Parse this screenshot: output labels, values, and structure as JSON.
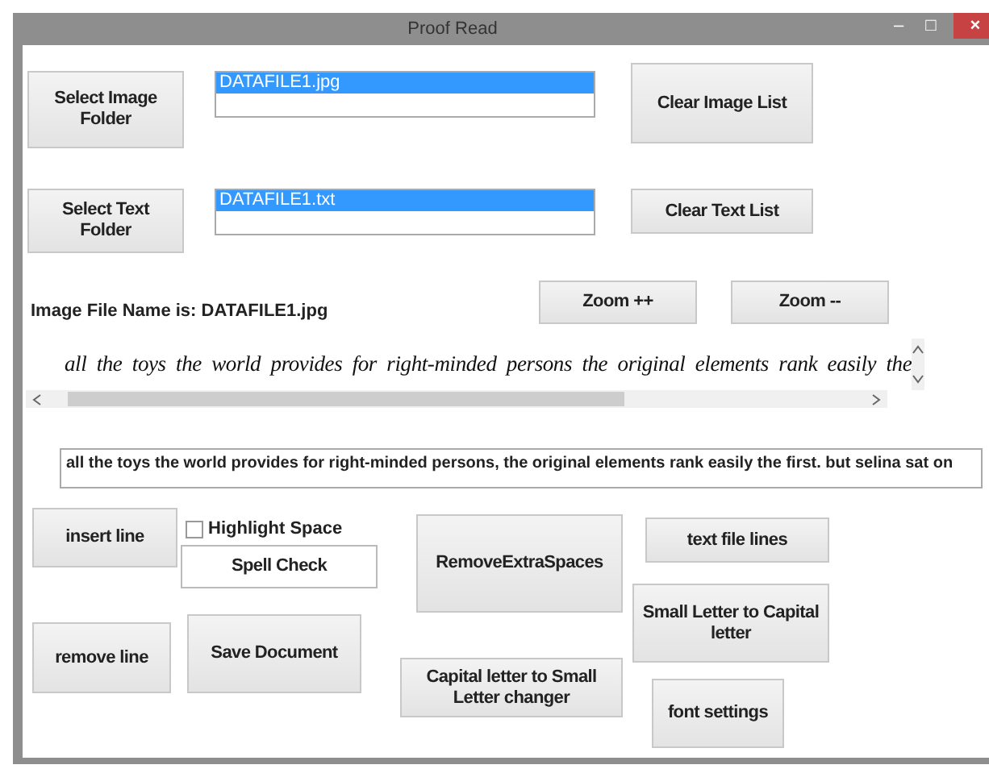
{
  "window": {
    "title": "Proof Read",
    "controls": [
      "–",
      "□",
      "×"
    ]
  },
  "image_folder_button": "Select Image\nFolder",
  "image_list": {
    "items": [
      {
        "label": "DATAFILE1.jpg",
        "selected": true
      }
    ]
  },
  "clear_image_button": "Clear Image List",
  "text_folder_button": "Select Text\nFolder",
  "text_list": {
    "items": [
      {
        "label": "DATAFILE1.txt",
        "selected": true
      }
    ]
  },
  "clear_text_button": "Clear Text List",
  "image_file_label": "Image File Name is: DATAFILE1.jpg",
  "zoom_buttons": [
    "Zoom ++",
    "Zoom --"
  ],
  "image_text": "all the toys the world provides for right-minded persons the original elements rank easily the",
  "text_field": {
    "value": "all the toys the world provides for right-minded persons, the original elements rank easily the first. but selina sat on"
  },
  "insert_line_button": "insert line",
  "remove_line_button": "remove line",
  "highlight_space": {
    "label": "Highlight Space",
    "checked": false
  },
  "spell_check_button": "Spell Check",
  "save_button": "Save Document",
  "remove_spaces_button": "RemoveExtraSpaces",
  "lower_case_button": "Capital letter to Small\nLetter changer",
  "text_file_lines_button": "text file lines",
  "upper_case_button": "Small Letter to Capital\nletter",
  "font_settings_button": "font settings"
}
